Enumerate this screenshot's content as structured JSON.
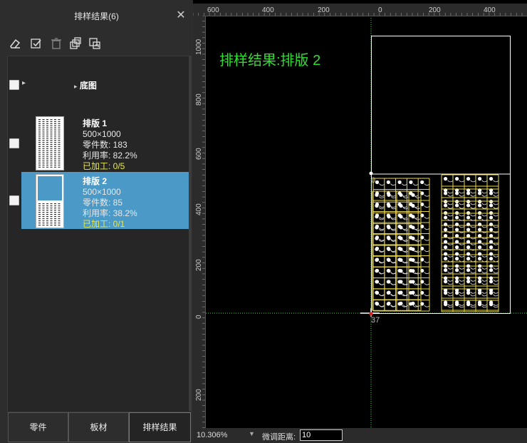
{
  "panel": {
    "title": "排样结果(6)",
    "close_icon": "close-icon",
    "toolbar": [
      "eraser-icon",
      "check-square-icon",
      "trash-icon",
      "stack-icon",
      "export-icon"
    ],
    "base_row": {
      "label": "底图"
    },
    "sheets": [
      {
        "name": "排版 1",
        "size": "500×1000",
        "parts": "零件数: 183",
        "util": "利用率: 82.2%",
        "done": "已加工: 0/5",
        "selected": false
      },
      {
        "name": "排版 2",
        "size": "500×1000",
        "parts": "零件数: 85",
        "util": "利用率: 38.2%",
        "done": "已加工: 0/1",
        "selected": true
      }
    ],
    "tabs": [
      "零件",
      "板材",
      "排样结果"
    ],
    "active_tab": "排样结果"
  },
  "canvas": {
    "title": "排样结果:排版 2",
    "ruler_top": [
      "600",
      "400",
      "200",
      "0",
      "200",
      "400"
    ],
    "ruler_left": [
      "1000",
      "800",
      "600",
      "400",
      "200",
      "0",
      "200"
    ],
    "marker_top": "0",
    "marker_bottom": "37",
    "colors": {
      "title": "#2fdc2f",
      "parts": "#e8d64a",
      "background": "#000000",
      "highlight": "#4a99c7"
    }
  },
  "status": {
    "zoom": "10.306%",
    "fine_label": "微调距离:",
    "fine_value": "10"
  }
}
